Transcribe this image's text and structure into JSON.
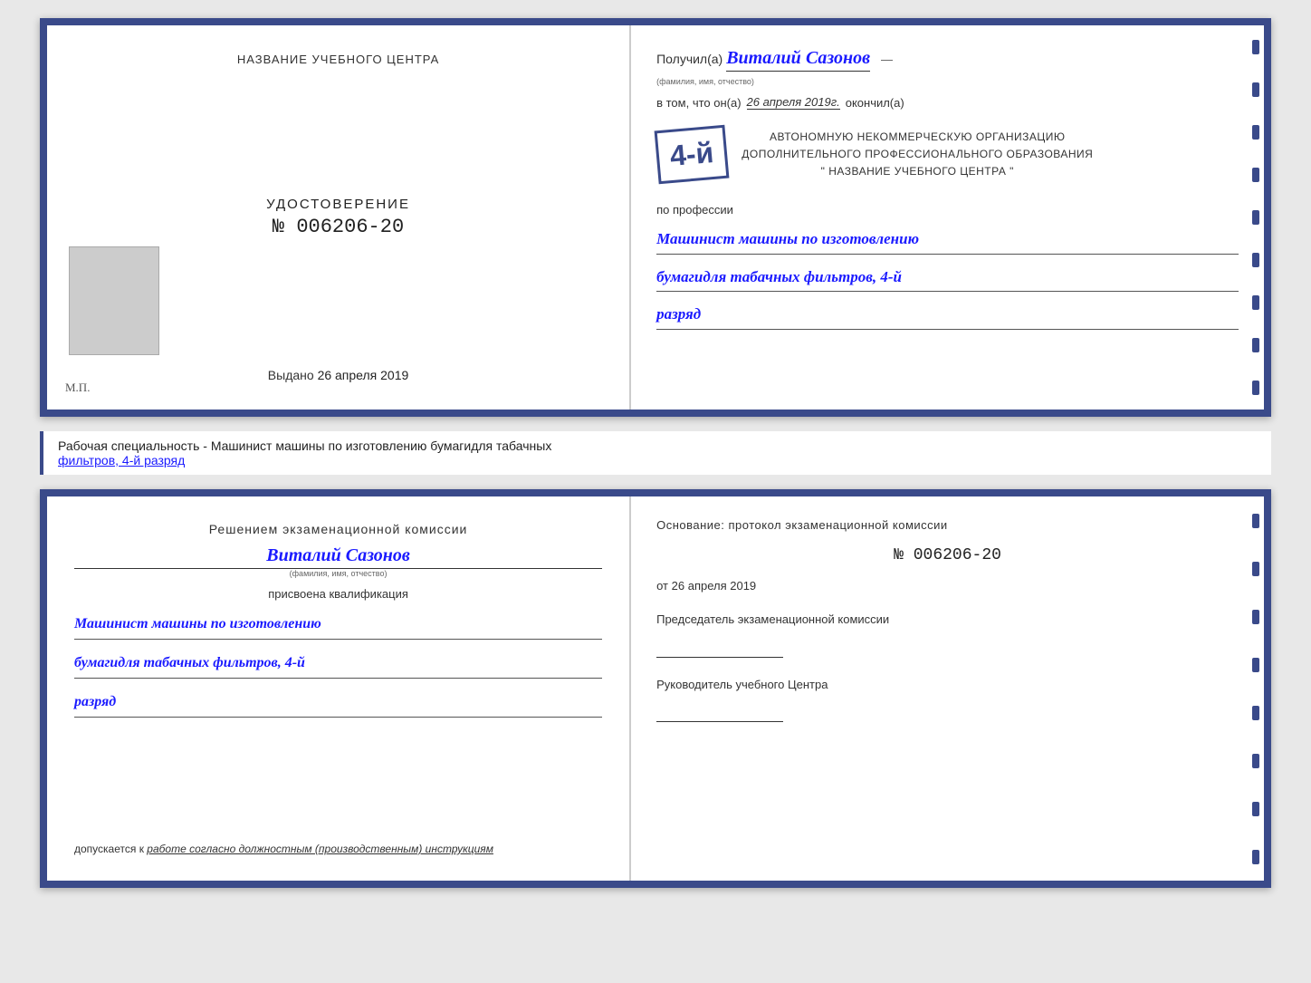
{
  "page": {
    "background_color": "#e8e8e8"
  },
  "cert_top": {
    "left": {
      "org_name_label": "НАЗВАНИЕ УЧЕБНОГО ЦЕНТРА",
      "udostoverenie_title": "УДОСТОВЕРЕНИЕ",
      "udostoverenie_number": "№ 006206-20",
      "vydano_label": "Выдано",
      "vydano_date": "26 апреля 2019",
      "mp_label": "М.П."
    },
    "right": {
      "poluchil_label": "Получил(а)",
      "person_name": "Виталий Сазонов",
      "fio_label": "(фамилия, имя, отчество)",
      "vtom_label": "в том, что он(а)",
      "date_handwritten": "26 апреля 2019г.",
      "okonchil_label": "окончил(а)",
      "stamp_number": "4-й",
      "org_line1": "АВТОНОМНУЮ НЕКОММЕРЧЕСКУЮ ОРГАНИЗАЦИЮ",
      "org_line2": "ДОПОЛНИТЕЛЬНОГО ПРОФЕССИОНАЛЬНОГО ОБРАЗОВАНИЯ",
      "org_line3": "\" НАЗВАНИЕ УЧЕБНОГО ЦЕНТРА \"",
      "po_professii_label": "по профессии",
      "profession_line1": "Машинист машины по изготовлению",
      "profession_line2": "бумагидля табачных фильтров, 4-й",
      "profession_line3": "разряд"
    }
  },
  "subtitle": {
    "text_prefix": "Рабочая специальность - Машинист машины по изготовлению бумагидля табачных",
    "text_underline": "фильтров, 4-й разряд"
  },
  "cert_bottom": {
    "left": {
      "decision_text": "Решением  экзаменационной  комиссии",
      "person_name": "Виталий Сазонов",
      "fio_label": "(фамилия, имя, отчество)",
      "prisvоena_text": "присвоена квалификация",
      "qual_line1": "Машинист машины по изготовлению",
      "qual_line2": "бумагидля табачных фильтров, 4-й",
      "qual_line3": "разряд",
      "dopusk_prefix": "допускается к",
      "dopusk_text": "работе согласно должностным (производственным) инструкциям"
    },
    "right": {
      "osnovanie_text": "Основание: протокол экзаменационной  комиссии",
      "protocol_number": "№ 006206-20",
      "ot_label": "от",
      "ot_date": "26 апреля 2019",
      "predsedatel_title": "Председатель экзаменационной комиссии",
      "rukovoditel_title": "Руководитель учебного Центра"
    }
  }
}
